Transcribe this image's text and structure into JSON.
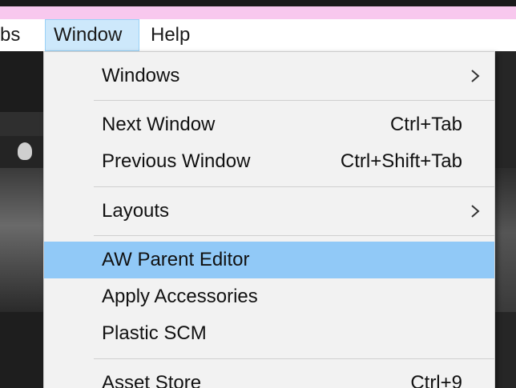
{
  "menubar": {
    "items": [
      {
        "label": "bs"
      },
      {
        "label": "Window"
      },
      {
        "label": "Help"
      }
    ]
  },
  "window_menu": {
    "items": [
      {
        "label": "Windows",
        "shortcut": "",
        "submenu": true
      },
      {
        "label": "Next Window",
        "shortcut": "Ctrl+Tab"
      },
      {
        "label": "Previous Window",
        "shortcut": "Ctrl+Shift+Tab"
      },
      {
        "label": "Layouts",
        "shortcut": "",
        "submenu": true
      },
      {
        "label": "AW Parent Editor",
        "shortcut": "",
        "highlighted": true
      },
      {
        "label": "Apply Accessories",
        "shortcut": ""
      },
      {
        "label": "Plastic SCM",
        "shortcut": ""
      },
      {
        "label": "Asset Store",
        "shortcut": "Ctrl+9"
      }
    ]
  },
  "colors": {
    "highlight": "#91c9f7",
    "menu_bg": "#f2f2f2",
    "menubar_active": "#cde8fb",
    "pink_strip": "#f8c8ee"
  },
  "icons": {
    "submenu": "chevron-right-icon",
    "lamp": "lightbulb-icon"
  }
}
